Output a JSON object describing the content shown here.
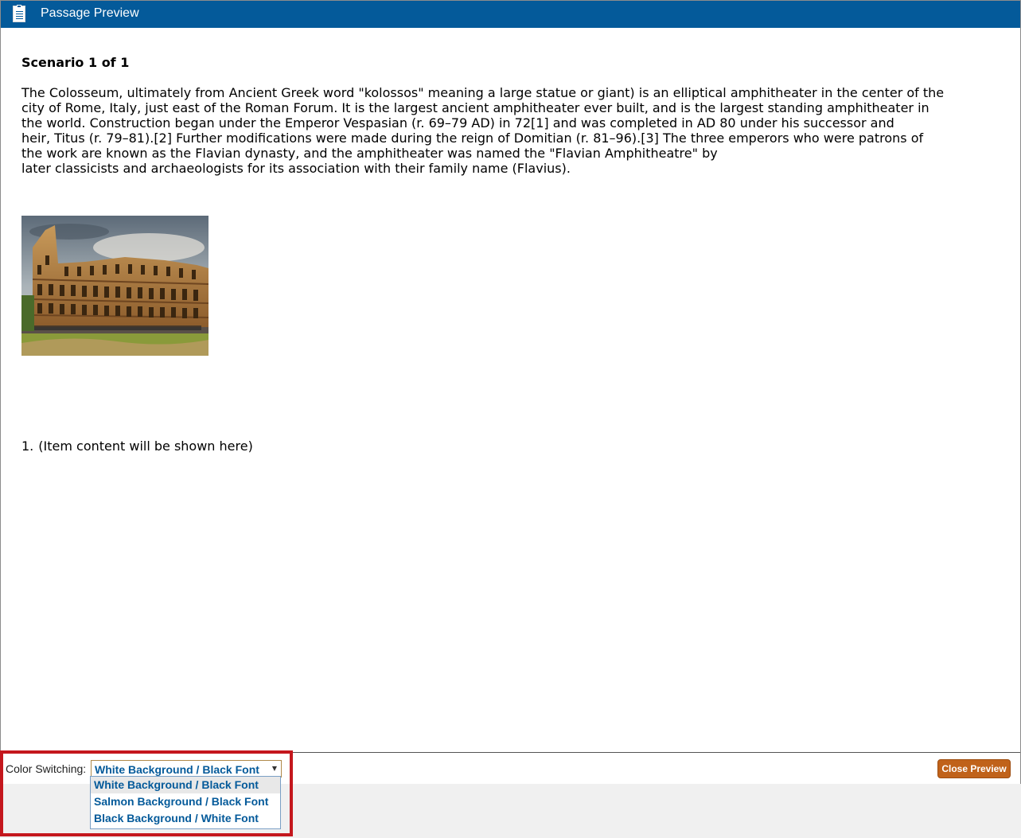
{
  "window": {
    "title": "Passage Preview",
    "icon": "document-clipboard-icon"
  },
  "passage": {
    "heading": "Scenario 1 of 1",
    "lines": [
      "The Colosseum, ultimately from Ancient Greek word \"kolossos\" meaning a large statue or giant) is an elliptical amphitheater in the center of the",
      "city of Rome, Italy, just east of the Roman Forum. It is the largest ancient amphitheater ever built, and is the largest standing amphitheater in",
      "the world. Construction began under the Emperor Vespasian (r. 69–79 AD) in 72[1] and was completed in AD 80 under his successor and",
      "heir, Titus (r. 79–81).[2] Further modifications were made during the reign of Domitian (r. 81–96).[3] The three emperors who were patrons of",
      "the work are known as the Flavian dynasty, and the amphitheater was named the \"Flavian Amphitheatre\" by",
      "later classicists and archaeologists for its association with their family name (Flavius)."
    ],
    "image": "colosseum-photo"
  },
  "item": {
    "number": "1.",
    "text": "(Item content will be shown here)"
  },
  "footer": {
    "color_switching_label": "Color Switching:",
    "selected_option": "White Background / Black Font",
    "options": [
      "White Background / Black Font",
      "Salmon Background / Black Font",
      "Black Background / White Font"
    ],
    "close_button": "Close Preview"
  },
  "colors": {
    "titlebar": "#045a9a",
    "option_text": "#045a9a",
    "close_button": "#c0621a",
    "highlight": "#c4171d"
  }
}
